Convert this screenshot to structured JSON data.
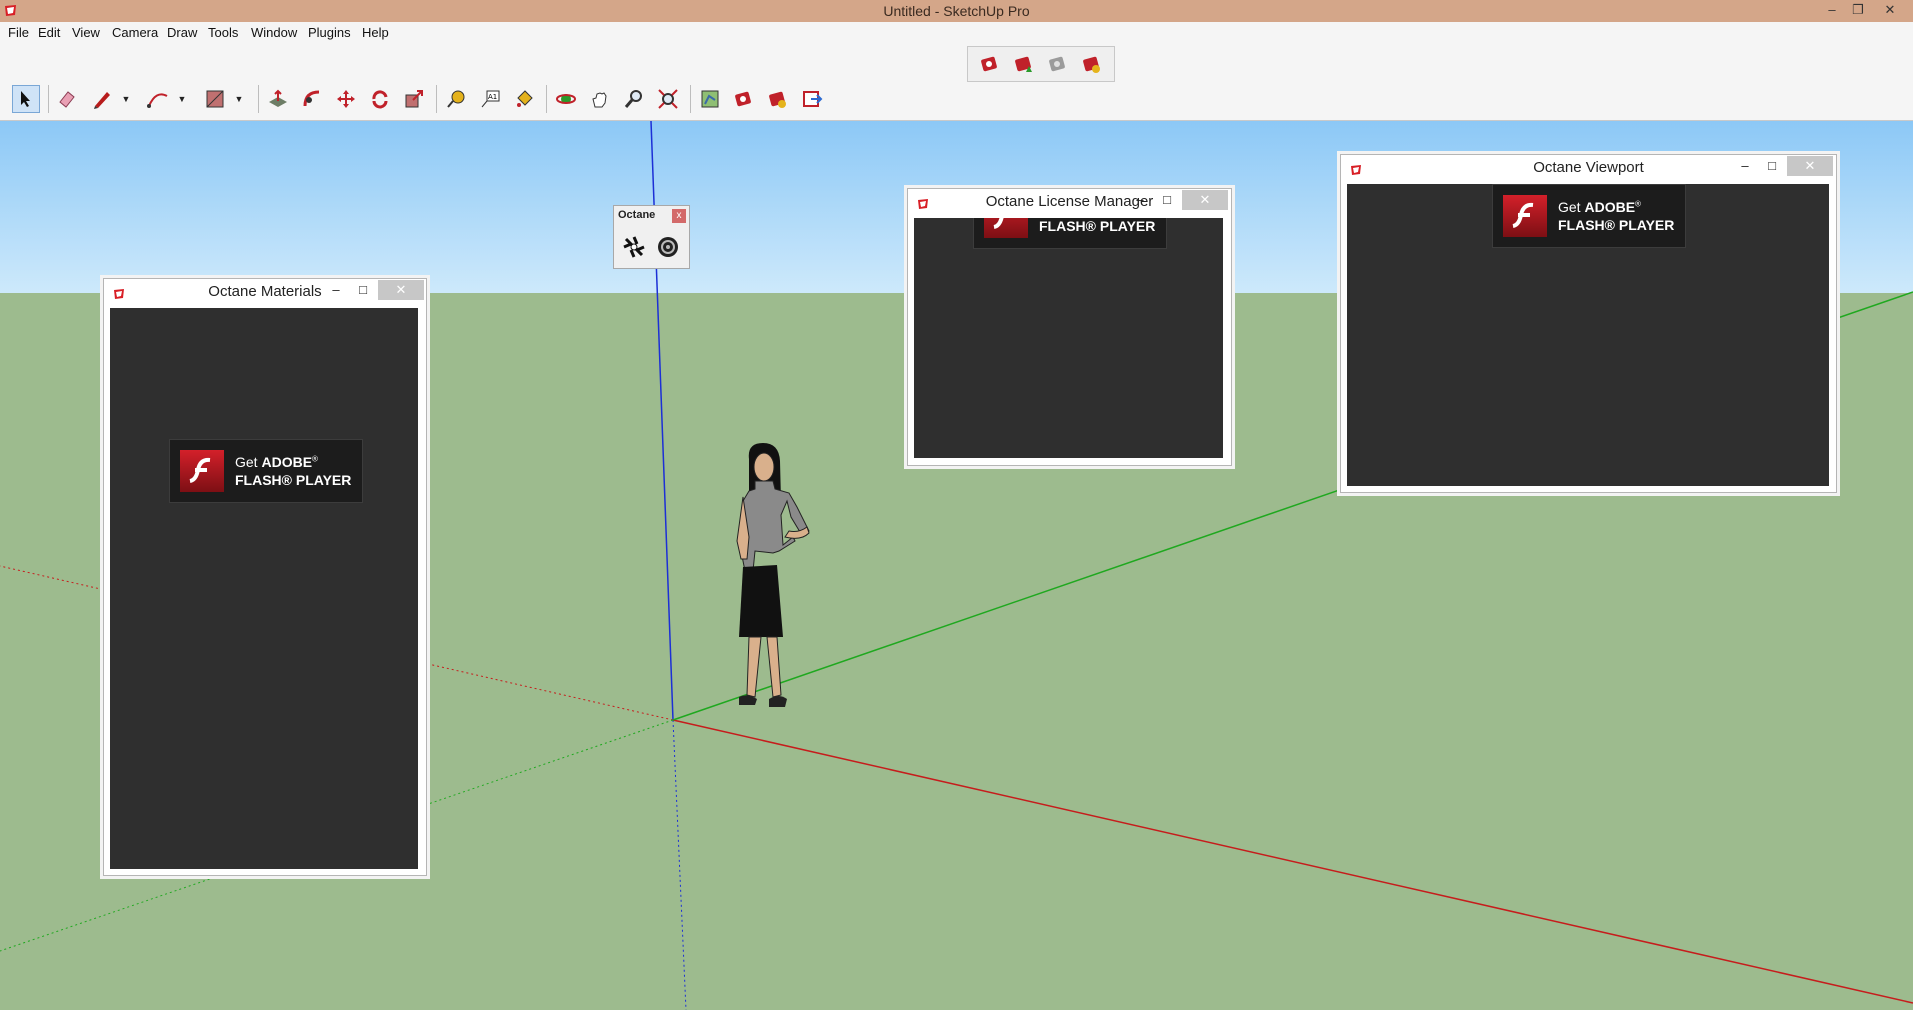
{
  "app": {
    "title": "Untitled - SketchUp Pro",
    "icon": "sketchup-icon",
    "controls": {
      "minimize": "‒",
      "restore": "❐",
      "close": "✕"
    }
  },
  "menu": [
    "File",
    "Edit",
    "View",
    "Camera",
    "Draw",
    "Tools",
    "Window",
    "Plugins",
    "Help"
  ],
  "toolbar": {
    "tools": [
      "select-tool",
      "eraser-tool",
      "pencil-tool",
      "arc-tool",
      "rectangle-tool",
      "push-pull-tool",
      "follow-me-tool",
      "move-tool",
      "rotate-tool",
      "scale-tool",
      "tape-measure-tool",
      "text-tool",
      "paint-bucket-tool",
      "orbit-tool",
      "pan-tool",
      "zoom-tool",
      "zoom-extents-tool",
      "previous-view-tool",
      "octane-render-tool",
      "octane-materials-tool",
      "octane-export-tool"
    ],
    "floating_tools": [
      "octane-live-tool",
      "octane-upload-tool",
      "octane-disabled-tool",
      "octane-settings-tool"
    ]
  },
  "octane_palette": {
    "title": "Octane",
    "close": "x",
    "buttons": [
      "aperture-icon",
      "shutter-icon"
    ]
  },
  "dialogs": {
    "materials": {
      "title": "Octane Materials",
      "minimize": "‒",
      "maximize": "□",
      "close": "✕"
    },
    "license": {
      "title": "Octane License Manager",
      "minimize": "‒",
      "maximize": "□",
      "close": "✕"
    },
    "viewport": {
      "title": "Octane Viewport",
      "minimize": "‒",
      "maximize": "□",
      "close": "✕"
    }
  },
  "flash": {
    "get": "Get",
    "adobe": "ADOBE",
    "reg": "®",
    "player": "FLASH® PLAYER"
  },
  "colors": {
    "sky_top": "#8cc8f6",
    "ground": "#9dbb8e",
    "dialog_body": "#2f2f2f",
    "flash_red": "#d3202a",
    "axis_red": "#c61c1c",
    "axis_green": "#1fa81f",
    "axis_blue": "#1c2fd6"
  }
}
